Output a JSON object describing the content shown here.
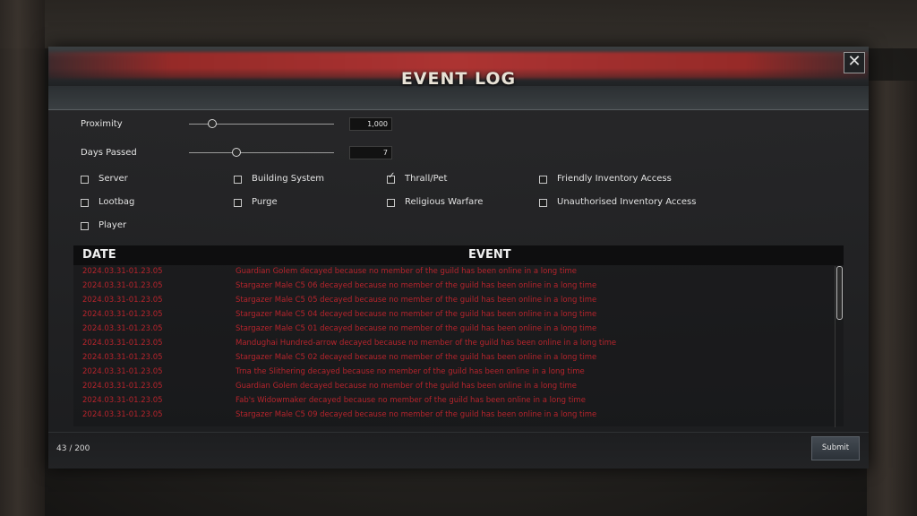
{
  "window": {
    "title": "EVENT LOG",
    "close_icon": "close-icon"
  },
  "controls": {
    "proximity": {
      "label": "Proximity",
      "value": "1,000",
      "level": 0.16
    },
    "days_passed": {
      "label": "Days Passed",
      "value": "7",
      "level": 0.33
    }
  },
  "filters": [
    {
      "label": "Server",
      "checked": false
    },
    {
      "label": "Building System",
      "checked": false
    },
    {
      "label": "Thrall/Pet",
      "checked": true
    },
    {
      "label": "Friendly Inventory Access",
      "checked": false
    },
    {
      "label": "Lootbag",
      "checked": false
    },
    {
      "label": "Purge",
      "checked": false
    },
    {
      "label": "Religious Warfare",
      "checked": false
    },
    {
      "label": "Unauthorised Inventory Access",
      "checked": false
    },
    {
      "label": "Player",
      "checked": false
    }
  ],
  "log": {
    "columns": {
      "date": "DATE",
      "event": "EVENT"
    },
    "rows": [
      {
        "date": "2024.03.31-01.23.05",
        "event": "Guardian Golem decayed because no member of the guild has been online in a long time"
      },
      {
        "date": "2024.03.31-01.23.05",
        "event": "Stargazer Male C5 06 decayed because no member of the guild has been online in a long time"
      },
      {
        "date": "2024.03.31-01.23.05",
        "event": "Stargazer Male C5 05 decayed because no member of the guild has been online in a long time"
      },
      {
        "date": "2024.03.31-01.23.05",
        "event": "Stargazer Male C5 04 decayed because no member of the guild has been online in a long time"
      },
      {
        "date": "2024.03.31-01.23.05",
        "event": "Stargazer Male C5 01 decayed because no member of the guild has been online in a long time"
      },
      {
        "date": "2024.03.31-01.23.05",
        "event": "Mandughai Hundred-arrow decayed because no member of the guild has been online in a long time"
      },
      {
        "date": "2024.03.31-01.23.05",
        "event": "Stargazer Male C5 02 decayed because no member of the guild has been online in a long time"
      },
      {
        "date": "2024.03.31-01.23.05",
        "event": "Trna the Slithering decayed because no member of the guild has been online in a long time"
      },
      {
        "date": "2024.03.31-01.23.05",
        "event": "Guardian Golem decayed because no member of the guild has been online in a long time"
      },
      {
        "date": "2024.03.31-01.23.05",
        "event": "Fab's Widowmaker decayed because no member of the guild has been online in a long time"
      },
      {
        "date": "2024.03.31-01.23.05",
        "event": "Stargazer Male C5 09 decayed because no member of the guild has been online in a long time"
      }
    ]
  },
  "footer": {
    "counter": "43 / 200",
    "submit_label": "Submit"
  },
  "colors": {
    "event_text": "#b6242c",
    "header_red": "#b43533"
  }
}
